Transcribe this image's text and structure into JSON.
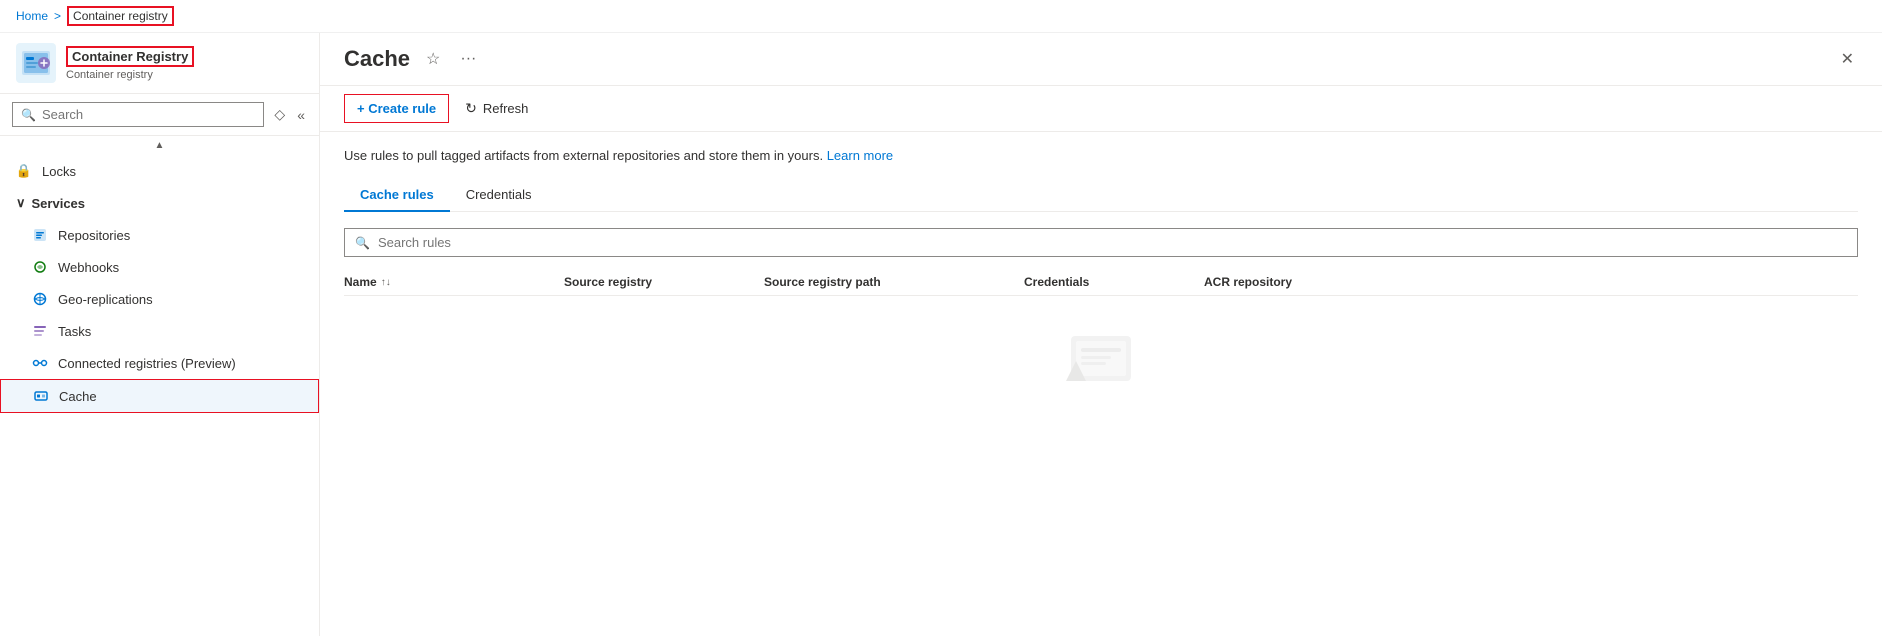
{
  "breadcrumb": {
    "home": "Home",
    "separator": ">",
    "current": "Container registry"
  },
  "resource": {
    "name": "Container Registry",
    "subtitle": "Container registry",
    "page_title": "Cache"
  },
  "search": {
    "placeholder": "Search"
  },
  "toolbar": {
    "create_rule_label": "+ Create rule",
    "refresh_label": "Refresh"
  },
  "info": {
    "text": "Use rules to pull tagged artifacts from external repositories and store them in yours.",
    "learn_more": "Learn more"
  },
  "tabs": [
    {
      "id": "cache-rules",
      "label": "Cache rules",
      "active": true
    },
    {
      "id": "credentials",
      "label": "Credentials",
      "active": false
    }
  ],
  "search_rules": {
    "placeholder": "Search rules"
  },
  "table": {
    "columns": [
      {
        "label": "Name",
        "sortable": true
      },
      {
        "label": "Source registry",
        "sortable": false
      },
      {
        "label": "Source registry path",
        "sortable": false
      },
      {
        "label": "Credentials",
        "sortable": false
      },
      {
        "label": "ACR repository",
        "sortable": false
      }
    ]
  },
  "sidebar": {
    "locks": "Locks",
    "services_section": "Services",
    "nav_items": [
      {
        "id": "repositories",
        "label": "Repositories",
        "icon": "repos-icon"
      },
      {
        "id": "webhooks",
        "label": "Webhooks",
        "icon": "webhooks-icon"
      },
      {
        "id": "geo-replications",
        "label": "Geo-replications",
        "icon": "geo-icon"
      },
      {
        "id": "tasks",
        "label": "Tasks",
        "icon": "tasks-icon"
      },
      {
        "id": "connected-registries",
        "label": "Connected registries (Preview)",
        "icon": "connected-icon"
      },
      {
        "id": "cache",
        "label": "Cache",
        "icon": "cache-icon",
        "active": true
      }
    ]
  },
  "close_button": "✕",
  "star_button": "☆",
  "ellipsis_button": "···"
}
